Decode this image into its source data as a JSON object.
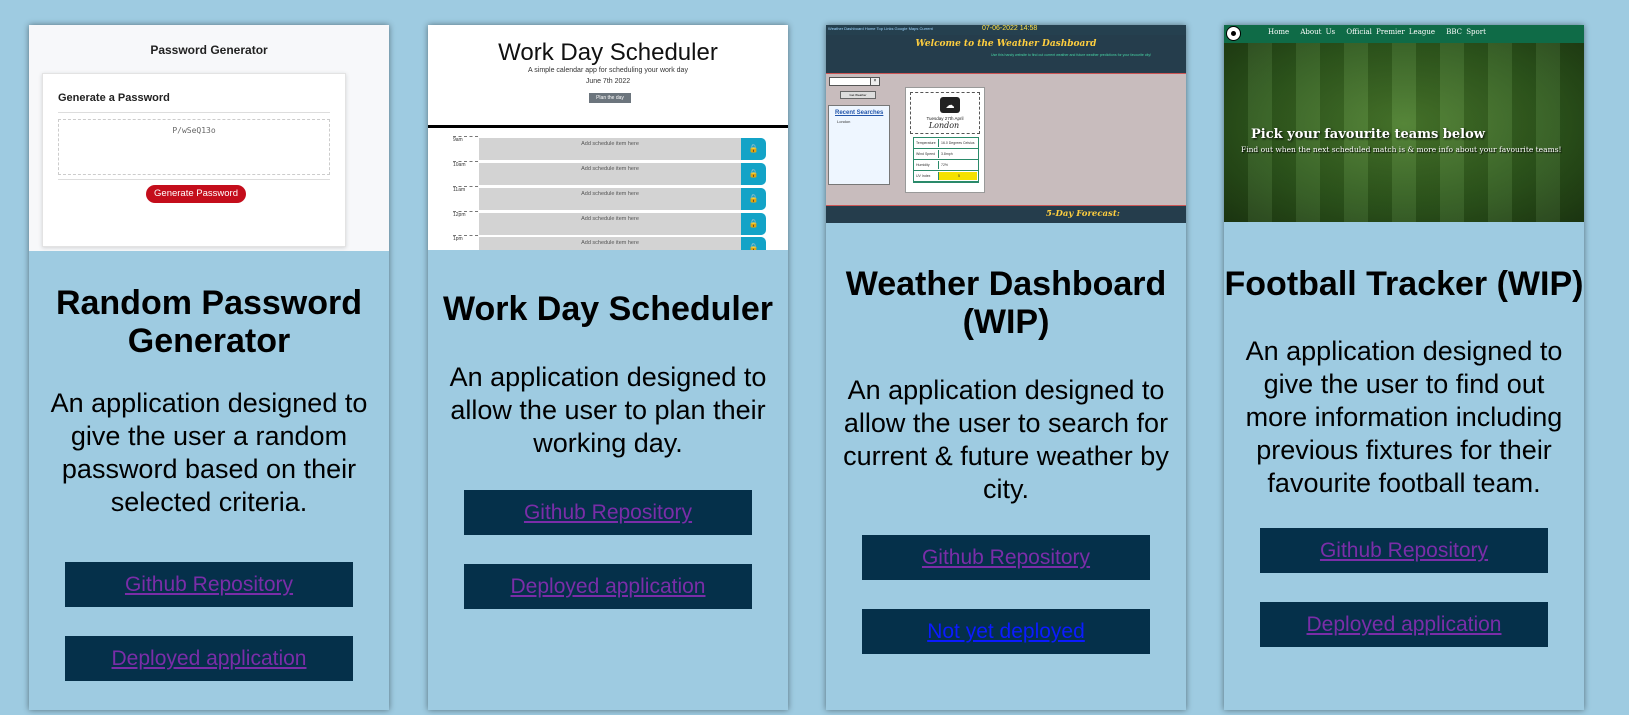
{
  "projects": [
    {
      "title": "Random Password Generator",
      "description": "An application designed to give the user a random password based on their selected criteria.",
      "repo_label": "Github Repository",
      "deploy_label": "Deployed application",
      "preview": {
        "heading": "Password Generator",
        "subheading": "Generate a Password",
        "password": "P/wSeQ13o",
        "button": "Generate Password"
      }
    },
    {
      "title": "Work Day Scheduler",
      "description": "An application designed to allow the user to plan their working day.",
      "repo_label": "Github Repository",
      "deploy_label": "Deployed application",
      "preview": {
        "heading": "Work Day Scheduler",
        "subheading": "A simple calendar app for scheduling your work day",
        "date": "June 7th 2022",
        "button": "Plan the day",
        "hours": [
          "9am",
          "10am",
          "11am",
          "12pm",
          "1pm"
        ],
        "placeholder": "Add schedule item here",
        "lock_icon": "lock-icon"
      }
    },
    {
      "title": "Weather Dashboard (WIP)",
      "description": "An application designed to allow the user to search for current & future weather by city.",
      "repo_label": "Github Repository",
      "deploy_label": "Not yet deployed",
      "preview": {
        "nav": "Weather Dashboard    Home    Top Links    Google Maps    Current",
        "timestamp": "07-06-2022 14:58",
        "heading": "Welcome to the Weather Dashboard",
        "subheading": "Use this handy website to find out current weather and future weather predictions for your favourite city!",
        "search_button": "Get Weather",
        "recent_heading": "Recent Searches",
        "recent_items": [
          "London"
        ],
        "day": "Tuesday 27th April",
        "city": "London",
        "stats": [
          {
            "key": "Temperature",
            "value": "16.0 Degrees Celsius"
          },
          {
            "key": "Wind Speed",
            "value": "3.8mph"
          },
          {
            "key": "Humidity",
            "value": "72%"
          },
          {
            "key": "UV Index",
            "value": "5"
          }
        ],
        "forecast_label": "5-Day Forecast:"
      }
    },
    {
      "title": "Football Tracker (WIP)",
      "description": "An application designed to give the user to find out more information including previous fixtures for their favourite football team.",
      "repo_label": "Github Repository",
      "deploy_label": "Deployed application",
      "preview": {
        "nav_links": [
          "Home",
          "About Us",
          "Official Premier League",
          "BBC Sport"
        ],
        "heading": "Pick your favourite teams below",
        "subheading": "Find out when the next scheduled match is & more info about your favourite teams!"
      }
    }
  ],
  "colors": {
    "page_bg": "#9ecbe1",
    "button_bg": "#05304a",
    "link_visited": "#7a2da8",
    "link_unvisited": "#0b1bff"
  }
}
